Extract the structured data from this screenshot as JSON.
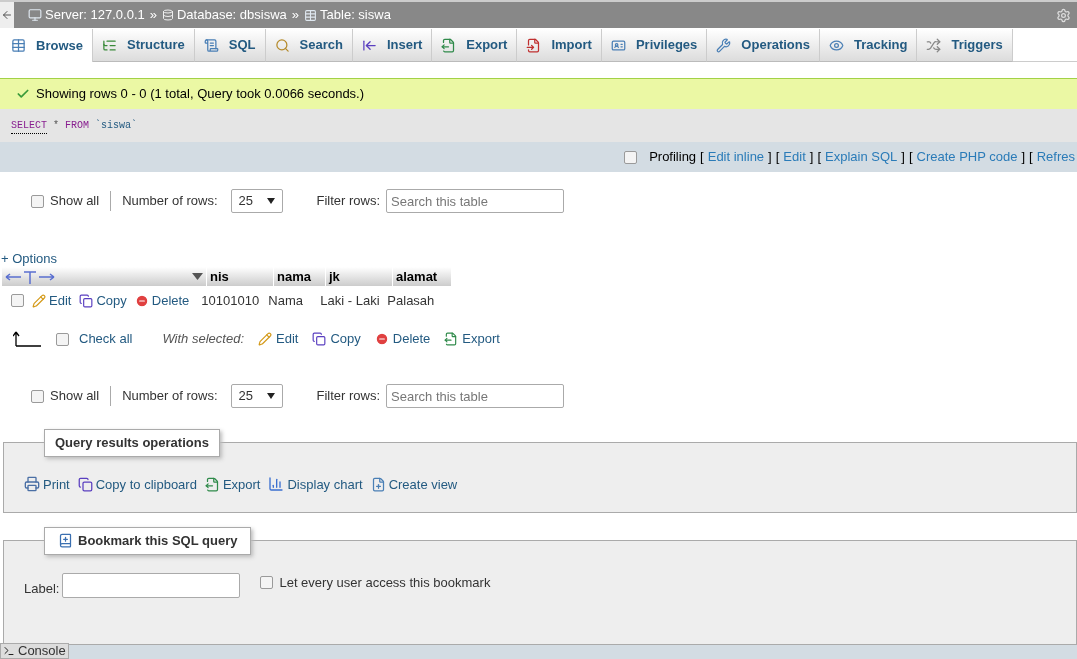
{
  "breadcrumb": {
    "items": [
      "Server: 127.0.0.1",
      "Database: dbsiswa",
      "Table: siswa"
    ],
    "separator": "»"
  },
  "tabs": [
    {
      "label": "Browse",
      "selected": true
    },
    {
      "label": "Structure",
      "selected": false
    },
    {
      "label": "SQL",
      "selected": false
    },
    {
      "label": "Search",
      "selected": false
    },
    {
      "label": "Insert",
      "selected": false
    },
    {
      "label": "Export",
      "selected": false
    },
    {
      "label": "Import",
      "selected": false
    },
    {
      "label": "Privileges",
      "selected": false
    },
    {
      "label": "Operations",
      "selected": false
    },
    {
      "label": "Tracking",
      "selected": false
    },
    {
      "label": "Triggers",
      "selected": false
    }
  ],
  "message": "Showing rows 0 - 0 (1 total, Query took 0.0066 seconds.)",
  "sql": [
    {
      "text": "SELECT",
      "kind": "keyword"
    },
    {
      "text": "*",
      "kind": "operator"
    },
    {
      "text": "FROM",
      "kind": "keyword"
    },
    {
      "text": "`siswa`",
      "kind": "identifier"
    }
  ],
  "profiling": {
    "label": "Profiling",
    "checked": false,
    "segments": [
      {
        "text": "[",
        "kind": "bracket"
      },
      {
        "text": "Edit inline",
        "kind": "link"
      },
      {
        "text": "]",
        "kind": "bracket"
      },
      {
        "text": "[",
        "kind": "bracket"
      },
      {
        "text": "Edit",
        "kind": "link"
      },
      {
        "text": "]",
        "kind": "bracket"
      },
      {
        "text": "[",
        "kind": "bracket"
      },
      {
        "text": "Explain SQL",
        "kind": "link"
      },
      {
        "text": "]",
        "kind": "bracket"
      },
      {
        "text": "[",
        "kind": "bracket"
      },
      {
        "text": "Create PHP code",
        "kind": "link"
      },
      {
        "text": "]",
        "kind": "bracket"
      },
      {
        "text": "[",
        "kind": "bracket"
      },
      {
        "text": "Refres",
        "kind": "link"
      }
    ]
  },
  "nav_top": {
    "show_all": {
      "label": "Show all",
      "checked": false
    },
    "rows_label": "Number of rows:",
    "rows_value": "25",
    "filter_label": "Filter rows:",
    "filter_placeholder": "Search this table"
  },
  "options_link": "+ Options",
  "table": {
    "columns": [
      "nis",
      "nama",
      "jk",
      "alamat"
    ],
    "rows": [
      {
        "checked": false,
        "actions": [
          "Edit",
          "Copy",
          "Delete"
        ],
        "cells": [
          "10101010",
          "Nama",
          "Laki - Laki",
          "Palasah"
        ]
      }
    ]
  },
  "bulk": {
    "check_all": {
      "label": "Check all",
      "checked": false
    },
    "with_selected": "With selected:",
    "actions": [
      "Edit",
      "Copy",
      "Delete",
      "Export"
    ]
  },
  "nav_bottom": {
    "show_all": {
      "label": "Show all",
      "checked": false
    },
    "rows_label": "Number of rows:",
    "rows_value": "25",
    "filter_label": "Filter rows:",
    "filter_placeholder": "Search this table"
  },
  "query_ops": {
    "title": "Query results operations",
    "actions": [
      "Print",
      "Copy to clipboard",
      "Export",
      "Display chart",
      "Create view"
    ]
  },
  "bookmark": {
    "title": "Bookmark this SQL query",
    "label": "Label:",
    "share": {
      "label": "Let every user access this bookmark",
      "checked": false
    }
  },
  "console": "Console"
}
